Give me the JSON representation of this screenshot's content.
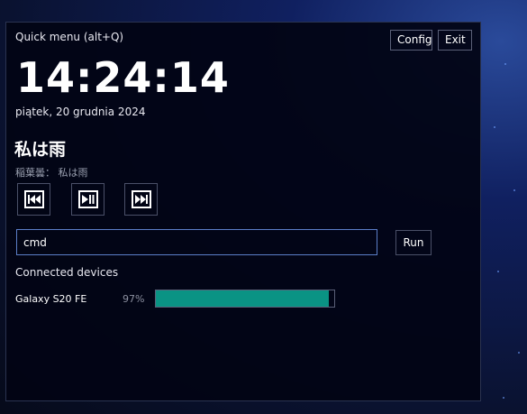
{
  "panel": {
    "title": "Quick menu  (alt+Q)",
    "config_label": "Config",
    "exit_label": "Exit"
  },
  "clock": {
    "time": "14:24:14",
    "date": "piątek, 20 grudnia 2024"
  },
  "media": {
    "title": "私は雨",
    "artist": "稲葉曇：  私は雨",
    "prev_icon": "skip-previous-icon",
    "play_pause_icon": "play-pause-icon",
    "next_icon": "skip-next-icon"
  },
  "command": {
    "value": "cmd",
    "run_label": "Run"
  },
  "devices": {
    "heading": "Connected devices",
    "items": [
      {
        "name": "Galaxy S20 FE",
        "battery_text": "97%",
        "battery_level": 0.97
      }
    ]
  },
  "colors": {
    "accent_fill": "#0a9384",
    "input_border": "#5b7ec8"
  }
}
